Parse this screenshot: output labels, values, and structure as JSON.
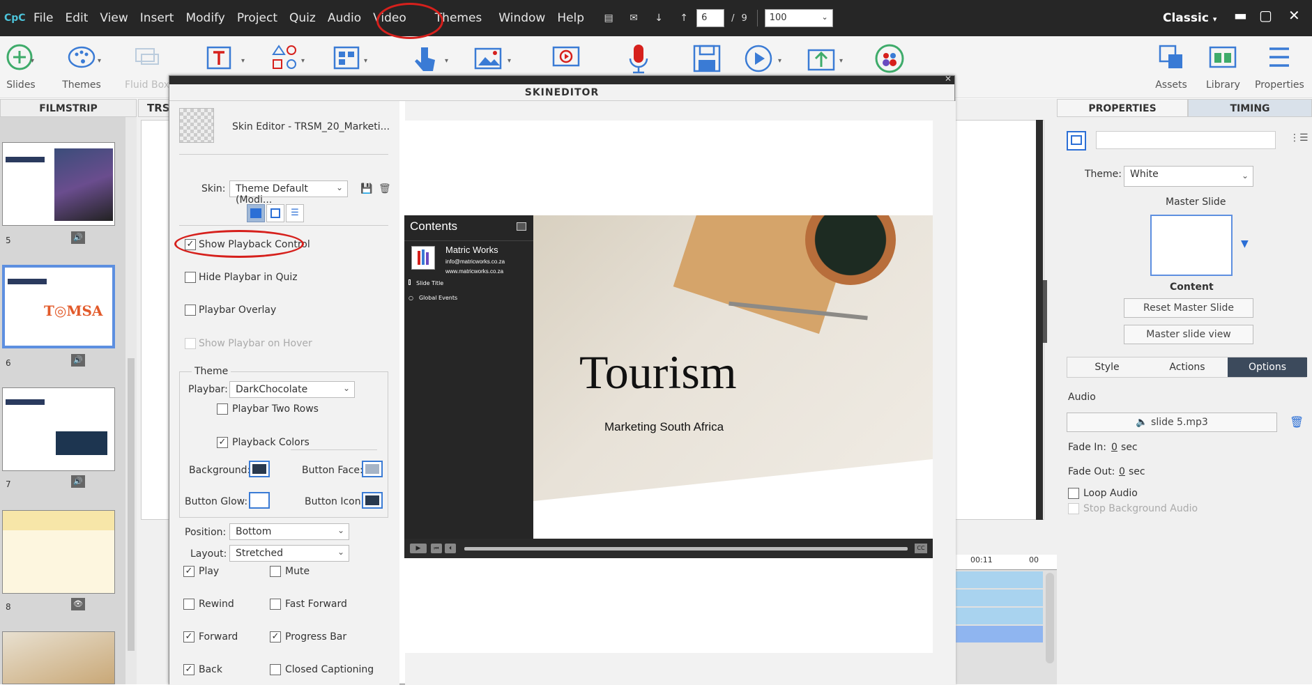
{
  "menubar": {
    "logo": "CpC",
    "items": [
      "File",
      "Edit",
      "View",
      "Insert",
      "Modify",
      "Project",
      "Quiz",
      "Audio",
      "Video",
      "Themes",
      "Window",
      "Help"
    ],
    "slide_current": "6",
    "slide_sep": "/",
    "slide_total": "9",
    "zoom": "100",
    "workspace": "Classic"
  },
  "toolbar": {
    "slides": "Slides",
    "themes": "Themes",
    "fluid_box": "Fluid Box",
    "assets": "Assets",
    "library": "Library",
    "properties": "Properties"
  },
  "filmstrip": {
    "header": "FILMSTRIP",
    "slide_numbers": [
      "5",
      "6",
      "7",
      "8"
    ],
    "tab_label": "TRS"
  },
  "skin_editor": {
    "title": "SKINEDITOR",
    "file_label": "Skin Editor - TRSM_20_Marketi...",
    "skin_label": "Skin:",
    "skin_value": "Theme Default (Modi...",
    "show_playback_control": "Show Playback Control",
    "hide_playbar_in_quiz": "Hide Playbar in Quiz",
    "playbar_overlay": "Playbar Overlay",
    "show_playbar_on_hover": "Show Playbar on Hover",
    "theme_group": "Theme",
    "playbar_label": "Playbar:",
    "playbar_value": "DarkChocolate",
    "playbar_two_rows": "Playbar Two Rows",
    "playback_colors": "Playback Colors",
    "background": "Background:",
    "button_face": "Button Face:",
    "button_glow": "Button Glow:",
    "button_icon": "Button Icon:",
    "position_label": "Position:",
    "position_value": "Bottom",
    "layout_label": "Layout:",
    "layout_value": "Stretched",
    "play": "Play",
    "mute": "Mute",
    "rewind": "Rewind",
    "fast_forward": "Fast Forward",
    "forward": "Forward",
    "progress_bar": "Progress Bar",
    "back": "Back",
    "closed_captioning": "Closed Captioning"
  },
  "preview": {
    "contents_title": "Contents",
    "author_name": "Matric Works",
    "author_email": "info@matricworks.co.za",
    "author_site": "www.matricworks.co.za",
    "toc_items": [
      "Slide Title",
      "Global Events"
    ],
    "slide_title": "Tourism",
    "slide_subtitle": "Marketing South Africa",
    "cc_label": "CC"
  },
  "properties": {
    "tab_properties": "PROPERTIES",
    "tab_timing": "TIMING",
    "theme_label": "Theme:",
    "theme_value": "White",
    "master_slide_label": "Master Slide",
    "master_name": "Content",
    "reset_master": "Reset Master Slide",
    "master_view": "Master slide view",
    "subtabs": [
      "Style",
      "Actions",
      "Options"
    ],
    "audio_heading": "Audio",
    "audio_file": "slide 5.mp3",
    "fade_in_label": "Fade In:",
    "fade_in_value": "0",
    "fade_out_label": "Fade Out:",
    "fade_out_value": "0",
    "sec": "sec",
    "loop_audio": "Loop Audio",
    "stop_bg_audio": "Stop Background Audio"
  },
  "timeline": {
    "time1": "00:11",
    "time2": "00"
  },
  "colors": {
    "accent": "#3a7bd5",
    "annotation": "#d6201c",
    "dark_bar": "#262626"
  }
}
